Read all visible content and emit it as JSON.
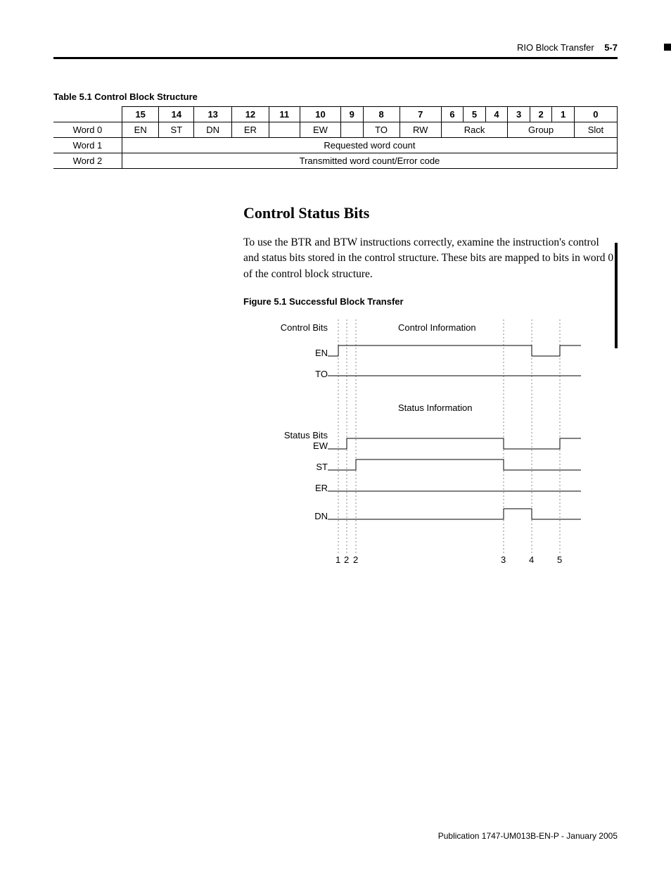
{
  "header": {
    "section": "RIO Block Transfer",
    "page": "5-7"
  },
  "table": {
    "caption": "Table 5.1 Control Block Structure",
    "bits": [
      "15",
      "14",
      "13",
      "12",
      "11",
      "10",
      "9",
      "8",
      "7",
      "6",
      "5",
      "4",
      "3",
      "2",
      "1",
      "0"
    ],
    "rows": [
      {
        "label": "Word 0",
        "cells": [
          {
            "text": "EN",
            "span": 1
          },
          {
            "text": "ST",
            "span": 1
          },
          {
            "text": "DN",
            "span": 1
          },
          {
            "text": "ER",
            "span": 1
          },
          {
            "text": "",
            "span": 1
          },
          {
            "text": "EW",
            "span": 1
          },
          {
            "text": "",
            "span": 1
          },
          {
            "text": "TO",
            "span": 1
          },
          {
            "text": "RW",
            "span": 1
          },
          {
            "text": "Rack",
            "span": 3
          },
          {
            "text": "Group",
            "span": 3
          },
          {
            "text": "Slot",
            "span": 1
          }
        ]
      },
      {
        "label": "Word 1",
        "cells": [
          {
            "text": "Requested word count",
            "span": 16
          }
        ]
      },
      {
        "label": "Word 2",
        "cells": [
          {
            "text": "Transmitted word count/Error code",
            "span": 16
          }
        ]
      }
    ]
  },
  "section": {
    "heading": "Control Status Bits",
    "body": "To use the BTR and BTW instructions correctly, examine the instruction's control and status bits stored in the control structure. These bits are mapped to bits in word 0 of the control block structure."
  },
  "figure": {
    "caption": "Figure 5.1 Successful Block Transfer",
    "labels": {
      "controlBits": "Control Bits",
      "controlInfo": "Control Information",
      "statusBits": "Status Bits",
      "statusInfo": "Status Information",
      "EN": "EN",
      "TO": "TO",
      "EW": "EW",
      "ST": "ST",
      "ER": "ER",
      "DN": "DN",
      "n1": "1",
      "n2a": "2",
      "n2b": "2",
      "n3": "3",
      "n4": "4",
      "n5": "5"
    }
  },
  "footer": "Publication 1747-UM013B-EN-P - January 2005",
  "chart_data": {
    "type": "timing-diagram",
    "title": "Figure 5.1 Successful Block Transfer",
    "time_markers": [
      1,
      2,
      2,
      3,
      4,
      5
    ],
    "groups": [
      {
        "name": "Control Information",
        "signals": [
          "EN",
          "TO"
        ]
      },
      {
        "name": "Status Information",
        "signals": [
          "EW",
          "ST",
          "ER",
          "DN"
        ]
      }
    ],
    "signals": {
      "EN": {
        "waveform": "low,rise@1,high,fall@4,low,rise@5,high"
      },
      "TO": {
        "waveform": "low"
      },
      "EW": {
        "waveform": "low,rise@2a,high,fall@3,low,rise@5,high"
      },
      "ST": {
        "waveform": "low,rise@2b,high,fall@3,low"
      },
      "ER": {
        "waveform": "low"
      },
      "DN": {
        "waveform": "low,rise@3,high,fall@4,low"
      }
    }
  }
}
